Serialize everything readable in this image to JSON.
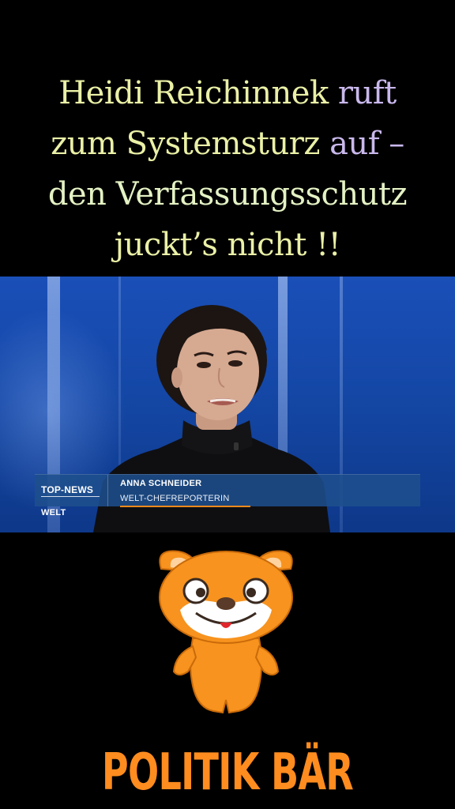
{
  "headline": {
    "line1": {
      "part1": "Heidi Reichinnek",
      "part2": " ruft"
    },
    "line2": {
      "part1": "zum Systemsturz",
      "part2": " auf –"
    },
    "line3": {
      "part1": "den Verfassungsschutz"
    },
    "line4": {
      "part1": "juckt’s nicht !!"
    }
  },
  "video": {
    "lower_third": {
      "program": "TOP-NEWS",
      "name": "ANNA SCHNEIDER",
      "role": "WELT-CHEFREPORTERIN"
    },
    "channel_logo": "WELT"
  },
  "brand": {
    "name": "POLITIK BÄR",
    "color": "#ff8c1f"
  },
  "colors": {
    "headline_yellow": "#eaf0a6",
    "headline_lilac": "#c9b8ec",
    "studio_blue": "#1447a6",
    "lower_third_accent": "#f08a1c"
  }
}
